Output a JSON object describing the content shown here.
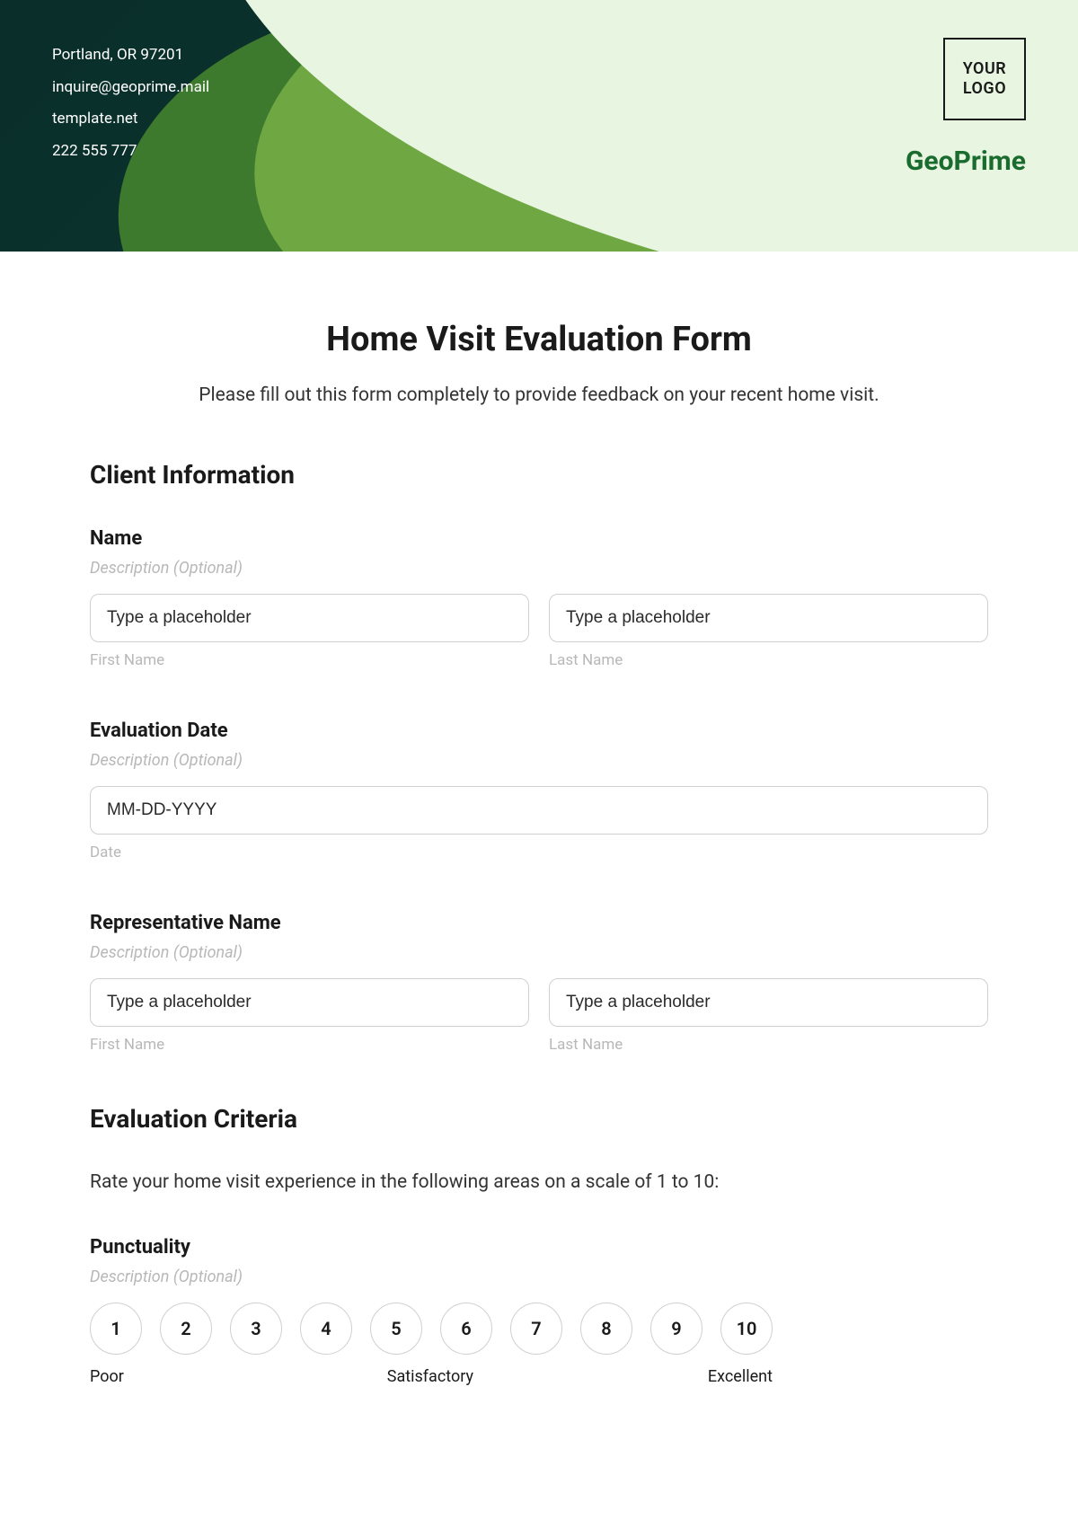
{
  "header": {
    "contact": {
      "address": "Portland, OR 97201",
      "email": "inquire@geoprime.mail",
      "site": "template.net",
      "phone": "222 555 777"
    },
    "logo_text": "YOUR LOGO",
    "brand": "GeoPrime"
  },
  "form": {
    "title": "Home Visit Evaluation Form",
    "intro": "Please fill out this form completely to provide feedback on your recent home visit.",
    "sections": {
      "client_info": {
        "heading": "Client Information",
        "name": {
          "label": "Name",
          "desc": "Description (Optional)",
          "first_placeholder": "Type a placeholder",
          "last_placeholder": "Type a placeholder",
          "first_sub": "First Name",
          "last_sub": "Last Name"
        },
        "eval_date": {
          "label": "Evaluation Date",
          "desc": "Description (Optional)",
          "placeholder": "MM-DD-YYYY",
          "sub": "Date"
        },
        "rep_name": {
          "label": "Representative Name",
          "desc": "Description (Optional)",
          "first_placeholder": "Type a placeholder",
          "last_placeholder": "Type a placeholder",
          "first_sub": "First Name",
          "last_sub": "Last Name"
        }
      },
      "criteria": {
        "heading": "Evaluation Criteria",
        "intro": "Rate your home visit experience in the following areas on a scale of 1 to 10:",
        "punctuality": {
          "label": "Punctuality",
          "desc": "Description (Optional)",
          "scale": [
            "1",
            "2",
            "3",
            "4",
            "5",
            "6",
            "7",
            "8",
            "9",
            "10"
          ],
          "anchor_low": "Poor",
          "anchor_mid": "Satisfactory",
          "anchor_high": "Excellent"
        }
      }
    }
  }
}
